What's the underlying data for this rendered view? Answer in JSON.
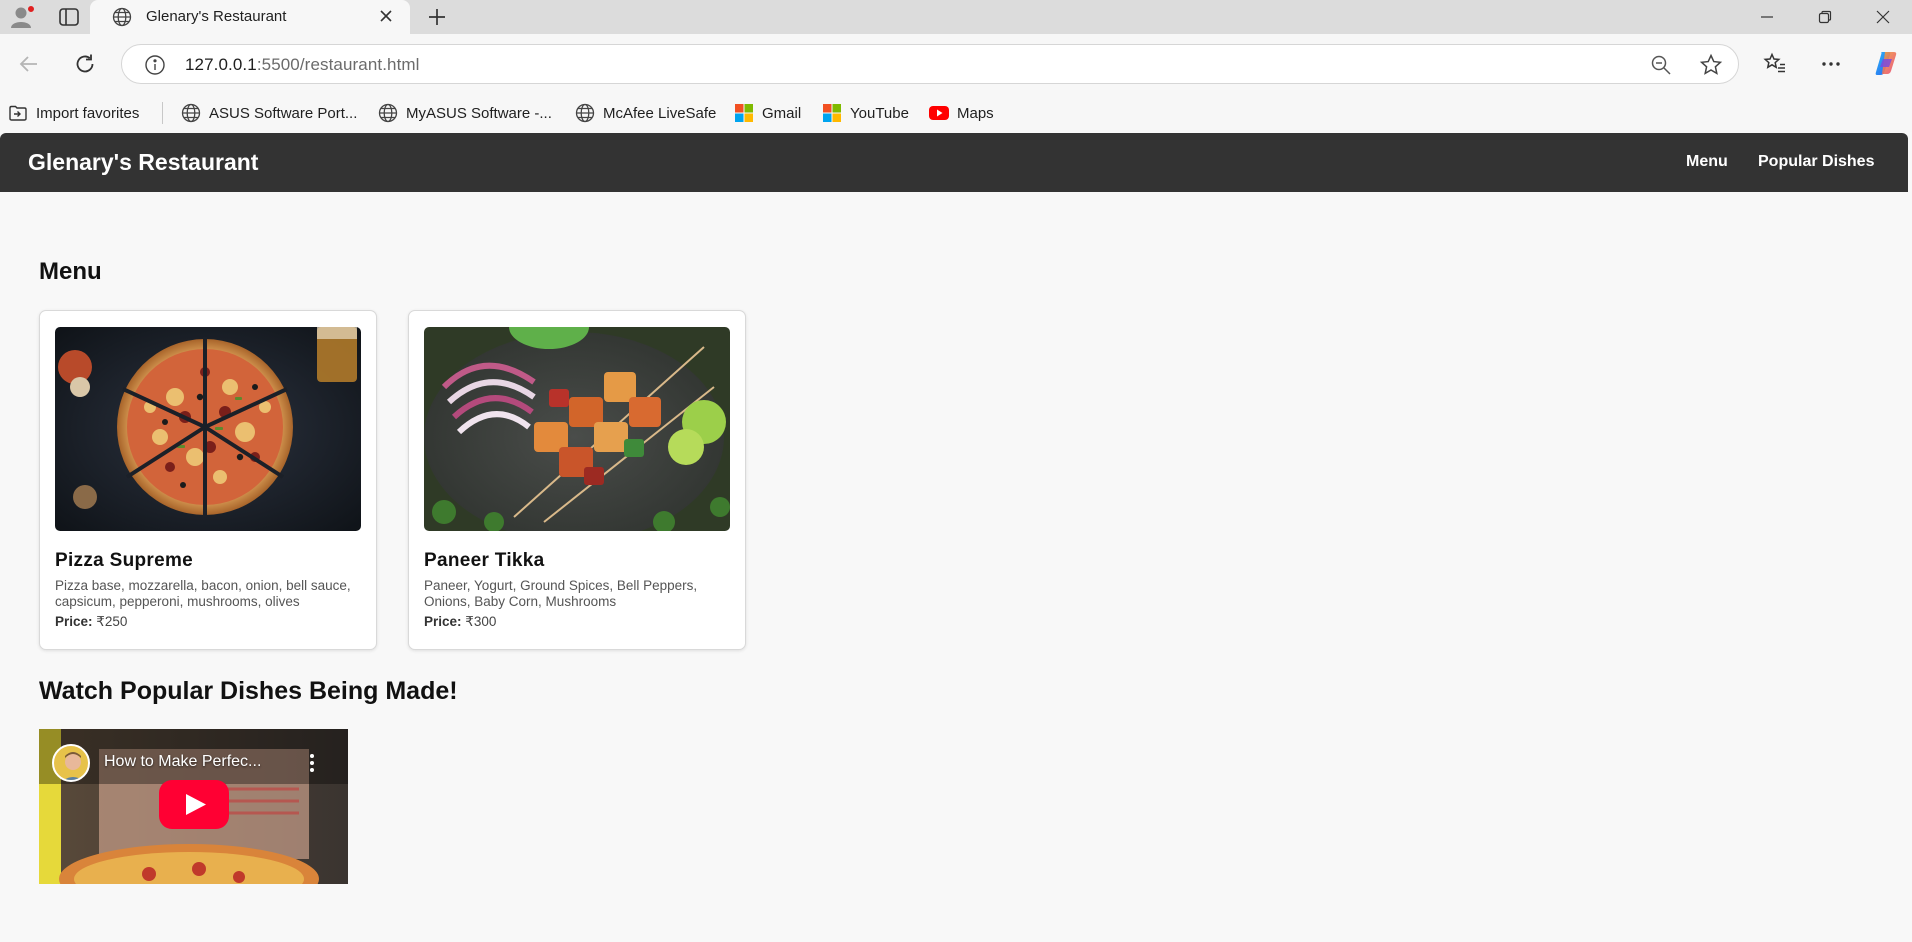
{
  "browser": {
    "tab_title": "Glenary's Restaurant",
    "url_host": "127.0.0.1",
    "url_rest": ":5500/restaurant.html",
    "bookmarks": [
      {
        "label": "Import favorites",
        "icon": "folder-import-icon"
      },
      {
        "label": "ASUS Software Port...",
        "icon": "globe-icon"
      },
      {
        "label": "MyASUS Software -...",
        "icon": "globe-icon"
      },
      {
        "label": "McAfee LiveSafe",
        "icon": "globe-icon"
      },
      {
        "label": "Gmail",
        "icon": "microsoft-logo-icon"
      },
      {
        "label": "YouTube",
        "icon": "microsoft-logo-icon"
      },
      {
        "label": "Maps",
        "icon": "youtube-icon"
      }
    ]
  },
  "site": {
    "title": "Glenary's Restaurant",
    "nav": [
      "Menu",
      "Popular Dishes"
    ]
  },
  "menu": {
    "heading": "Menu",
    "items": [
      {
        "name": "Pizza Supreme",
        "description": "Pizza base, mozzarella, bacon, onion, bell sauce, capsicum, pepperoni, mushrooms, olives",
        "price_label": "Price:",
        "price": "₹250"
      },
      {
        "name": "Paneer Tikka",
        "description": "Paneer, Yogurt, Ground Spices, Bell Peppers, Onions, Baby Corn, Mushrooms",
        "price_label": "Price:",
        "price": "₹300"
      }
    ]
  },
  "video_section": {
    "heading": "Watch Popular Dishes Being Made!",
    "video_title": "How to Make Perfec..."
  },
  "colors": {
    "header_bg": "#333333",
    "page_bg": "#f8f8f8",
    "youtube_red": "#ff0033"
  }
}
